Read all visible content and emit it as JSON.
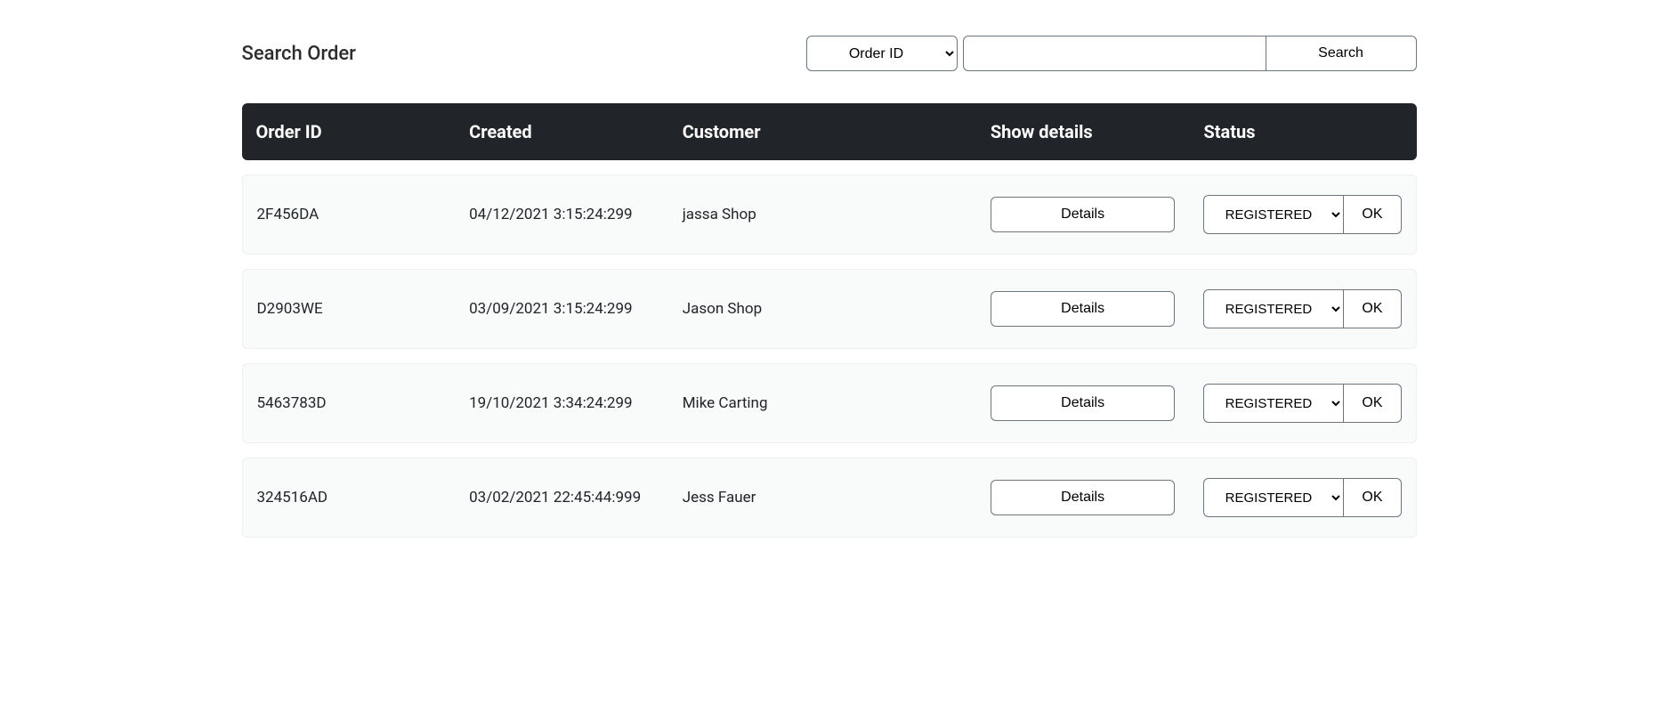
{
  "search": {
    "title": "Search Order",
    "select_options": [
      "Order ID"
    ],
    "selected": "Order ID",
    "input_value": "",
    "button_label": "Search"
  },
  "table": {
    "headers": {
      "order_id": "Order ID",
      "created": "Created",
      "customer": "Customer",
      "show_details": "Show details",
      "status": "Status"
    },
    "details_button_label": "Details",
    "ok_button_label": "OK",
    "status_options": [
      "REGISTERED"
    ],
    "rows": [
      {
        "order_id": "2F456DA",
        "created": "04/12/2021 3:15:24:299",
        "customer": "jassa Shop",
        "status": "REGISTERED"
      },
      {
        "order_id": "D2903WE",
        "created": "03/09/2021 3:15:24:299",
        "customer": "Jason Shop",
        "status": "REGISTERED"
      },
      {
        "order_id": "5463783D",
        "created": "19/10/2021 3:34:24:299",
        "customer": "Mike Carting",
        "status": "REGISTERED"
      },
      {
        "order_id": "324516AD",
        "created": "03/02/2021 22:45:44:999",
        "customer": "Jess Fauer",
        "status": "REGISTERED"
      }
    ]
  }
}
